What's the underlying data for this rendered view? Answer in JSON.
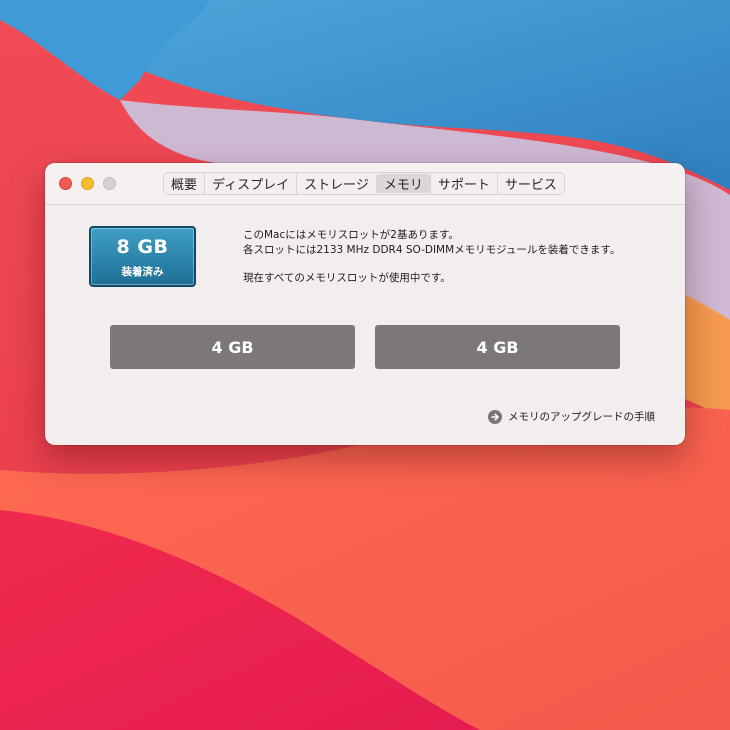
{
  "window": {
    "tabs": [
      {
        "label": "概要"
      },
      {
        "label": "ディスプレイ"
      },
      {
        "label": "ストレージ"
      },
      {
        "label": "メモリ"
      },
      {
        "label": "サポート"
      },
      {
        "label": "サービス"
      }
    ],
    "active_tab": "メモリ"
  },
  "memory": {
    "total": "8 GB",
    "status": "装着済み",
    "description_line1": "このMacにはメモリスロットが2基あります。",
    "description_line2": "各スロットには2133 MHz DDR4 SO-DIMMメモリモジュールを装着できます。",
    "description_line3": "現在すべてのメモリスロットが使用中です。",
    "slots": [
      {
        "label": "4 GB"
      },
      {
        "label": "4 GB"
      }
    ],
    "upgrade_link": "メモリのアップグレードの手順"
  },
  "colors": {
    "close": "#ee5a52",
    "minimize": "#f5bd2f",
    "zoom": "#d6d1d1",
    "memory_badge": "#2a86b0",
    "slot": "#7d7878"
  }
}
